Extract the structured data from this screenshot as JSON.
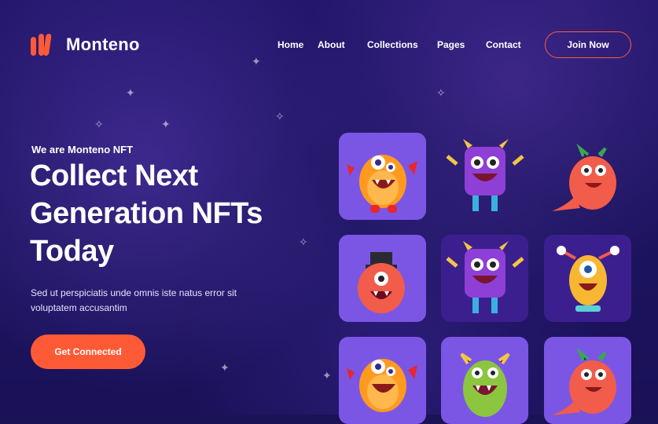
{
  "brand": {
    "name": "Monteno",
    "logo_icon": "monteno-logo-icon",
    "accent": "#ff5a36"
  },
  "nav": {
    "items": [
      {
        "label": "Home"
      },
      {
        "label": "About"
      },
      {
        "label": "Collections"
      },
      {
        "label": "Pages"
      },
      {
        "label": "Contact"
      }
    ],
    "join_label": "Join Now"
  },
  "hero": {
    "eyebrow": "We are Monteno NFT",
    "headline_lines": [
      "Collect Next",
      "Generation NFTs",
      "Today"
    ],
    "description": "Sed ut perspiciatis unde omnis iste natus error sit voluptatem accusantim",
    "cta_label": "Get Connected"
  },
  "collection": {
    "tiles": [
      {
        "icon": "orange-monster-icon"
      },
      {
        "icon": "purple-monster-icon"
      },
      {
        "icon": "red-dino-monster-icon"
      },
      {
        "icon": "red-hat-monster-icon"
      },
      {
        "icon": "purple-monster-icon"
      },
      {
        "icon": "yellow-cyclops-monster-icon"
      },
      {
        "icon": "orange-monster-icon"
      },
      {
        "icon": "green-monster-icon"
      },
      {
        "icon": "red-dino-monster-icon"
      }
    ]
  }
}
